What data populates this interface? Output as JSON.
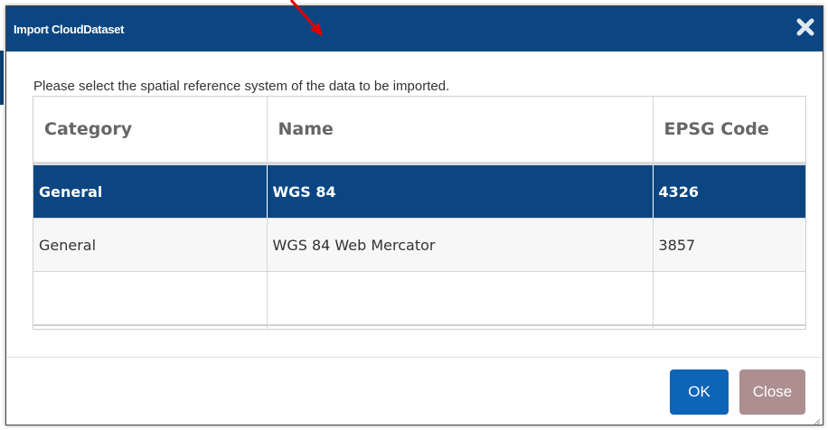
{
  "dialog": {
    "title": "Import CloudDataset",
    "instruction": "Please select the spatial reference system of the data to be imported.",
    "ok_label": "OK",
    "close_label": "Close"
  },
  "table": {
    "columns": [
      "Category",
      "Name",
      "EPSG Code"
    ],
    "rows": [
      {
        "category": "General",
        "name": "WGS 84",
        "epsg": "4326",
        "selected": true
      },
      {
        "category": "General",
        "name": "WGS 84 Web Mercator",
        "epsg": "3857",
        "selected": false
      }
    ]
  },
  "colors": {
    "titlebar": "#0c4682",
    "selected_row": "#0c4682",
    "ok_button": "#0e64b6",
    "close_button": "#ad8f8f",
    "annotation_arrow": "#e00000"
  },
  "icons": {
    "close": "close-x-icon",
    "arrow": "red-arrow-annotation",
    "resize": "resize-grip-icon"
  }
}
